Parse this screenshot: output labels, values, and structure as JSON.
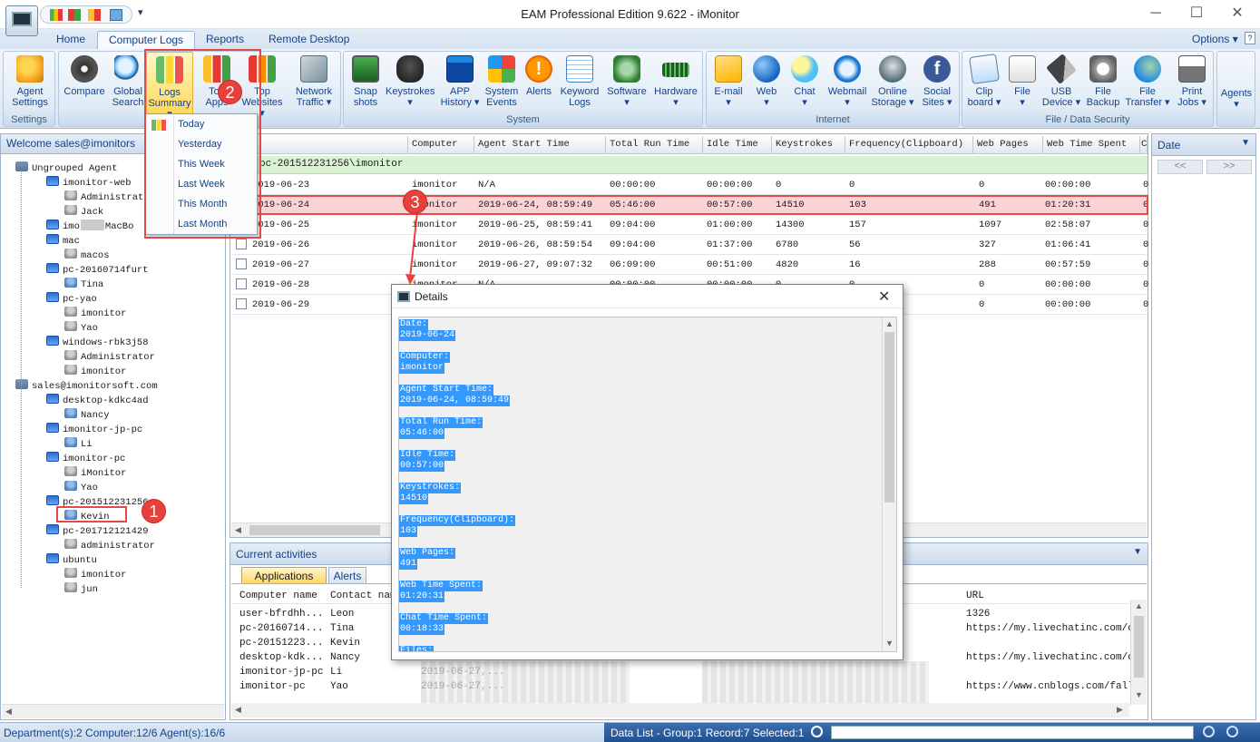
{
  "window": {
    "title": "EAM Professional Edition 9.622 - iMonitor",
    "minimize": "─",
    "maximize": "☐",
    "close": "✕"
  },
  "menu_tabs": [
    {
      "label": "Home",
      "active": false
    },
    {
      "label": "Computer Logs",
      "active": true
    },
    {
      "label": "Reports",
      "active": false
    },
    {
      "label": "Remote Desktop",
      "active": false
    }
  ],
  "options_label": "Options",
  "ribbon": {
    "groups": [
      {
        "label": "Settings",
        "buttons": [
          {
            "label": "Agent\nSettings",
            "icon": "agent-settings-icon"
          }
        ]
      },
      {
        "label": "",
        "buttons": [
          {
            "label": "Compare",
            "icon": "compare-icon"
          },
          {
            "label": "Global\nSearch",
            "icon": "magnifier-icon"
          },
          {
            "label": "Logs\nSummary",
            "icon": "bar-chart-icon",
            "active": true
          },
          {
            "label": "Top\nApps",
            "icon": "top-apps-icon"
          },
          {
            "label": "Top\nWebsites",
            "icon": "top-websites-icon"
          },
          {
            "label": "Network\nTraffic",
            "icon": "network-icon"
          }
        ]
      },
      {
        "label": "System",
        "buttons": [
          {
            "label": "Snap\nshots",
            "icon": "snapshot-icon"
          },
          {
            "label": "Keystrokes",
            "icon": "mouse-icon"
          },
          {
            "label": "APP\nHistory",
            "icon": "app-window-icon"
          },
          {
            "label": "System\nEvents",
            "icon": "windows-logo-icon"
          },
          {
            "label": "Alerts",
            "icon": "alert-icon"
          },
          {
            "label": "Keyword\nLogs",
            "icon": "keyword-logs-icon"
          },
          {
            "label": "Software",
            "icon": "software-icon"
          },
          {
            "label": "Hardware",
            "icon": "hardware-icon"
          }
        ]
      },
      {
        "label": "Internet",
        "buttons": [
          {
            "label": "E-mail",
            "icon": "envelope-icon"
          },
          {
            "label": "Web",
            "icon": "globe-icon"
          },
          {
            "label": "Chat",
            "icon": "chat-icon"
          },
          {
            "label": "Webmail",
            "icon": "webmail-icon"
          },
          {
            "label": "Online\nStorage",
            "icon": "online-storage-icon"
          },
          {
            "label": "Social\nSites",
            "icon": "facebook-icon"
          }
        ]
      },
      {
        "label": "File / Data Security",
        "buttons": [
          {
            "label": "Clip\nboard",
            "icon": "clipboard-icon"
          },
          {
            "label": "File",
            "icon": "file-icon"
          },
          {
            "label": "USB\nDevice",
            "icon": "usb-icon"
          },
          {
            "label": "File\nBackup",
            "icon": "file-backup-icon"
          },
          {
            "label": "File\nTransfer",
            "icon": "file-transfer-icon"
          },
          {
            "label": "Print\nJobs",
            "icon": "printer-icon"
          }
        ]
      },
      {
        "label": "",
        "buttons": [
          {
            "label": "Agents",
            "icon": "agents-icon"
          }
        ]
      }
    ]
  },
  "logs_summary_menu": [
    "Today",
    "Yesterday",
    "This Week",
    "Last Week",
    "This Month",
    "Last Month"
  ],
  "left_panel": {
    "header": "Welcome sales@imonitors",
    "tree": [
      {
        "label": "Ungrouped Agent",
        "level": 0,
        "type": "group"
      },
      {
        "label": "imonitor-web",
        "level": 1,
        "type": "pc"
      },
      {
        "label": "Administrato",
        "level": 2,
        "type": "usrg"
      },
      {
        "label": "Jack",
        "level": 2,
        "type": "usrg"
      },
      {
        "label": "imo",
        "level": 1,
        "type": "pc",
        "suffix": "MacBo"
      },
      {
        "label": "mac",
        "level": 1,
        "type": "pc"
      },
      {
        "label": "macos",
        "level": 2,
        "type": "usrg"
      },
      {
        "label": "pc-20160714furt",
        "level": 1,
        "type": "pc"
      },
      {
        "label": "Tina",
        "level": 2,
        "type": "usr"
      },
      {
        "label": "pc-yao",
        "level": 1,
        "type": "pc"
      },
      {
        "label": "imonitor",
        "level": 2,
        "type": "usrg"
      },
      {
        "label": "Yao",
        "level": 2,
        "type": "usrg"
      },
      {
        "label": "windows-rbk3j58",
        "level": 1,
        "type": "pc"
      },
      {
        "label": "Administrator",
        "level": 2,
        "type": "usrg"
      },
      {
        "label": "imonitor",
        "level": 2,
        "type": "usrg"
      },
      {
        "label": "sales@imonitorsoft.com",
        "level": 0,
        "type": "group"
      },
      {
        "label": "desktop-kdkc4ad",
        "level": 1,
        "type": "pc"
      },
      {
        "label": "Nancy",
        "level": 2,
        "type": "usr"
      },
      {
        "label": "imonitor-jp-pc",
        "level": 1,
        "type": "pc"
      },
      {
        "label": "Li",
        "level": 2,
        "type": "usr"
      },
      {
        "label": "imonitor-pc",
        "level": 1,
        "type": "pc"
      },
      {
        "label": "iMonitor",
        "level": 2,
        "type": "usrg"
      },
      {
        "label": "Yao",
        "level": 2,
        "type": "usr"
      },
      {
        "label": "pc-201512231256",
        "level": 1,
        "type": "pc"
      },
      {
        "label": "Kevin",
        "level": 2,
        "type": "usr"
      },
      {
        "label": "pc-201712121429",
        "level": 1,
        "type": "pc"
      },
      {
        "label": "administrator",
        "level": 2,
        "type": "usrg"
      },
      {
        "label": "ubuntu",
        "level": 1,
        "type": "pc"
      },
      {
        "label": "imonitor",
        "level": 2,
        "type": "usrg"
      },
      {
        "label": "jun",
        "level": 2,
        "type": "usrg"
      }
    ]
  },
  "grid": {
    "columns": [
      "Computer",
      "Agent Start Time",
      "Total Run Time",
      "Idle Time",
      "Keystrokes",
      "Frequency(Clipboard)",
      "Web Pages",
      "Web Time Spent",
      "C"
    ],
    "group_label": "pc-201512231256\\imonitor",
    "rows": [
      [
        "2019-06-23",
        "imonitor",
        "N/A",
        "00:00:00",
        "00:00:00",
        "0",
        "0",
        "0",
        "00:00:00",
        "0"
      ],
      [
        "2019-06-24",
        "imonitor",
        "2019-06-24, 08:59:49",
        "05:46:00",
        "00:57:00",
        "14510",
        "103",
        "491",
        "01:20:31",
        "0"
      ],
      [
        "2019-06-25",
        "imonitor",
        "2019-06-25, 08:59:41",
        "09:04:00",
        "01:00:00",
        "14300",
        "157",
        "1097",
        "02:58:07",
        "0"
      ],
      [
        "2019-06-26",
        "imonitor",
        "2019-06-26, 08:59:54",
        "09:04:00",
        "01:37:00",
        "6780",
        "56",
        "327",
        "01:06:41",
        "0"
      ],
      [
        "2019-06-27",
        "imonitor",
        "2019-06-27, 09:07:32",
        "06:09:00",
        "00:51:00",
        "4820",
        "16",
        "288",
        "00:57:59",
        "0"
      ],
      [
        "2019-06-28",
        "imonitor",
        "N/A",
        "00:00:00",
        "00:00:00",
        "0",
        "0",
        "0",
        "00:00:00",
        "0"
      ],
      [
        "2019-06-29",
        "imonitor",
        "N/A",
        "00:00:00",
        "00:00:00",
        "0",
        "0",
        "0",
        "00:00:00",
        "0"
      ]
    ]
  },
  "date_panel": {
    "header": "Date",
    "prev": "<<",
    "next": ">>"
  },
  "activities": {
    "header": "Current activities",
    "tabs": [
      "Applications",
      "Alerts"
    ],
    "columns": [
      "Computer name",
      "Contact nam",
      "URL"
    ],
    "rows": [
      {
        "computer": "user-bfrdhh...",
        "contact": "Leon",
        "time": "",
        "url": "1326"
      },
      {
        "computer": "pc-20160714...",
        "contact": "Tina",
        "time": "",
        "url": "https://my.livechatinc.com/cha"
      },
      {
        "computer": "pc-20151223...",
        "contact": "Kevin",
        "time": "",
        "url": ""
      },
      {
        "computer": "desktop-kdk...",
        "contact": "Nancy",
        "time": "",
        "url": "https://my.livechatinc.com/cha"
      },
      {
        "computer": "imonitor-jp-pc",
        "contact": "Li",
        "time": "2019-06-27,...",
        "url": ""
      },
      {
        "computer": "imonitor-pc",
        "contact": "Yao",
        "time": "2019-06-27,...",
        "url": "https://www.cnblogs.com/fallin"
      }
    ]
  },
  "details": {
    "title": "Details",
    "fields": [
      {
        "label": "Date:",
        "value": "2019-06-24"
      },
      {
        "label": "Computer:",
        "value": "imonitor"
      },
      {
        "label": "Agent Start Time:",
        "value": "2019-06-24, 08:59:49"
      },
      {
        "label": "Total Run Time:",
        "value": "05:46:00"
      },
      {
        "label": "Idle Time:",
        "value": "00:57:00"
      },
      {
        "label": "Keystrokes:",
        "value": "14510"
      },
      {
        "label": "Frequency(Clipboard):",
        "value": "103"
      },
      {
        "label": "Web Pages:",
        "value": "491"
      },
      {
        "label": "Web Time Spent:",
        "value": "01:20:31"
      },
      {
        "label": "Chat Time Spent:",
        "value": "00:18:33"
      },
      {
        "label": "Files:",
        "value": ""
      }
    ]
  },
  "status": {
    "left": "Department(s):2  Computer:12/6  Agent(s):16/6",
    "right": "Data List - Group:1  Record:7  Selected:1"
  },
  "callouts": [
    "1",
    "2",
    "3"
  ],
  "colors": {
    "accent": "#15428b",
    "highlight_row": "#fbd3d3",
    "group_row": "#d9f2d4",
    "selection": "#3399ff",
    "callout": "#e8413c"
  }
}
